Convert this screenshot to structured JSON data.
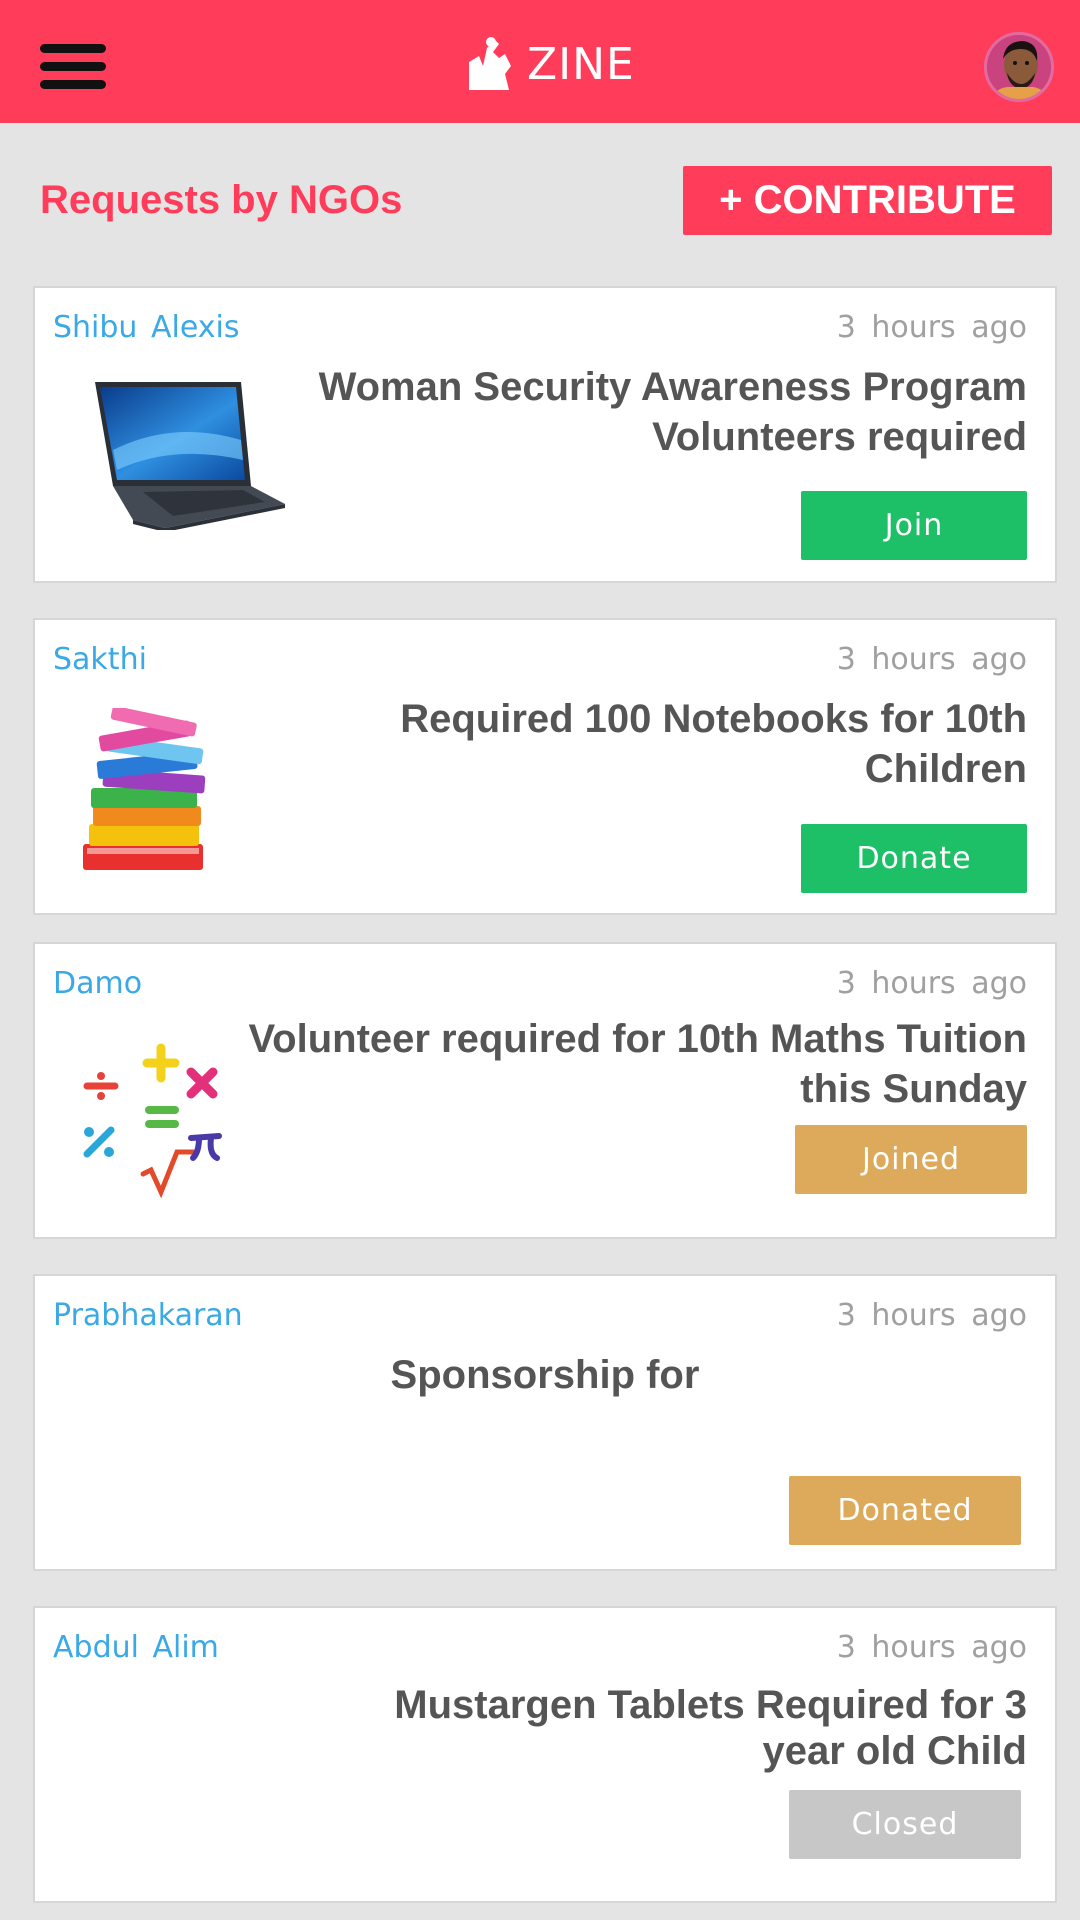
{
  "header": {
    "brand": "ZINE",
    "colors": {
      "primary": "#ff3d5a",
      "green": "#1dbf67",
      "gold": "#dcaa5a",
      "gray": "#c7c7c7",
      "author": "#3aa9e6"
    }
  },
  "main": {
    "section_title": "Requests by NGOs",
    "contribute_label": "+ CONTRIBUTE",
    "cards": [
      {
        "author": "Shibu  Alexis",
        "time": "3  hours  ago",
        "title_line1": "Woman Security Awareness Program",
        "title_line2": "Volunteers required",
        "action": "Join",
        "thumb_icon": "laptop-icon"
      },
      {
        "author": "Sakthi",
        "time": "3  hours  ago",
        "title_line1": "Required 100 Notebooks for 10th",
        "title_line2": "Children",
        "action": "Donate",
        "thumb_icon": "books-icon"
      },
      {
        "author": "Damo",
        "time": "3  hours  ago",
        "title_line1": "Volunteer required for 10th Maths Tuition",
        "title_line2": "this Sunday",
        "action": "Joined",
        "thumb_icon": "math-symbols-icon"
      },
      {
        "author": "Prabhakaran",
        "time": "3  hours  ago",
        "title_line1": "Sponsorship for",
        "title_line2": "",
        "action": "Donated"
      },
      {
        "author": "Abdul  Alim",
        "time": "3  hours  ago",
        "title_line1": "Mustargen Tablets Required for 3",
        "title_line2": "year old Child",
        "action": "Closed"
      }
    ]
  }
}
